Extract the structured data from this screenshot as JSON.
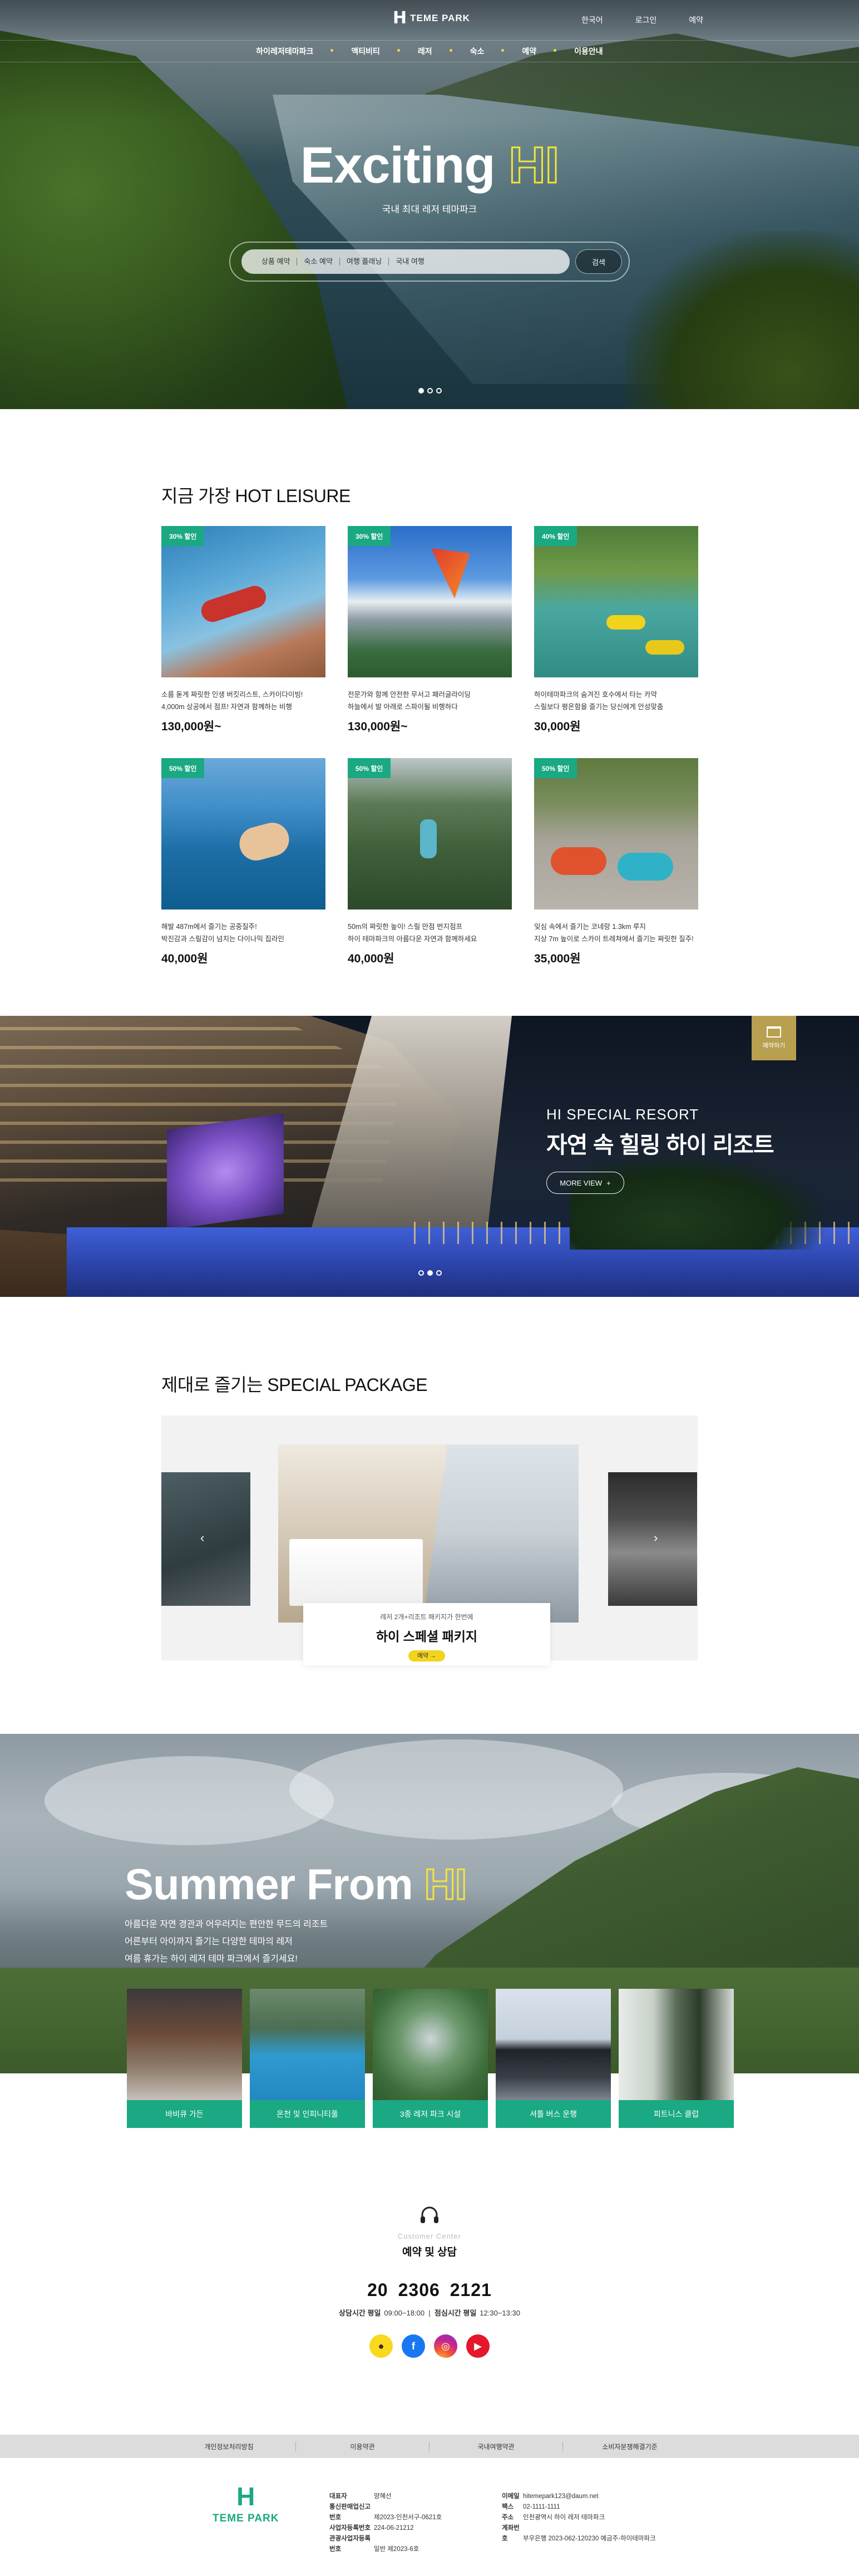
{
  "header": {
    "logo_text": "TEME PARK",
    "util": [
      "한국어",
      "로그인",
      "예약"
    ],
    "nav": [
      "하이레저테마파크",
      "액티비티",
      "레저",
      "숙소",
      "예약",
      "이용안내"
    ]
  },
  "hero": {
    "title_word": "Exciting",
    "title_hi": "HI",
    "subtitle": "국내 최대 레저 테마파크",
    "search_tabs": [
      "상품 예약",
      "숙소 예약",
      "여행 플래닝",
      "국내 여행"
    ],
    "search_button": "검색"
  },
  "hot": {
    "title": "지금 가장 HOT LEISURE",
    "items": [
      {
        "badge": "30% 할인",
        "desc1": "소름 돋게 짜릿한 인생 버킷리스트, 스카이다이빙!",
        "desc2": "4,000m 상공에서 점프! 자연과 함께하는 비행",
        "price": "130,000원~"
      },
      {
        "badge": "30% 할인",
        "desc1": "전문가와 함께 안전한 무서고 패러글라이딩",
        "desc2": "하늘에서 발 아래로 스파이될 비행하다",
        "price": "130,000원~"
      },
      {
        "badge": "40% 할인",
        "desc1": "하이테마파크의 숨겨진 호수에서 타는 카약",
        "desc2": "스릴보다 평온함을 즐기는 당신에게 안성맞춤",
        "price": "30,000원"
      },
      {
        "badge": "50% 할인",
        "desc1": "해발 487m에서 즐기는 공중질주!",
        "desc2": "박진감과 스릴감이 넘치는 다이나믹 집라인",
        "price": "40,000원"
      },
      {
        "badge": "50% 할인",
        "desc1": "50m의 짜릿한 높이! 스릴 만점 번지점프",
        "desc2": "하이 테마파크의 아름다운 자연과 함께하세요",
        "price": "40,000원"
      },
      {
        "badge": "50% 할인",
        "desc1": "잊심 속에서 즐기는 코네랑 1.3km 루지",
        "desc2": "지상 7m 높이로 스카이 트레쳐에서 즐기는 짜릿한 질주!",
        "price": "35,000원"
      }
    ]
  },
  "resort": {
    "tag": "예약하기",
    "eyebrow": "HI SPECIAL RESORT",
    "headline": "자연 속 힐링 하이 리조트",
    "more": "MORE VIEW"
  },
  "package": {
    "title": "제대로 즐기는  SPECIAL PACKAGE",
    "small": "레저 2개+리조트 패키지가 한번에",
    "name": "하이 스페셜 패키지",
    "button": "예약 →"
  },
  "summer": {
    "title_word": "Summer From",
    "title_hi": "HI",
    "lines": [
      "아름다운 자연 경관과 어우러지는 편안한 무드의 리조트",
      "어른부터 아이까지 즐기는 다양한 테마의 레저",
      "여름 휴가는 하이 레저 테마 파크에서 즐기세요!"
    ],
    "cards": [
      "바비큐 가든",
      "온천 및 인피니티풀",
      "3종 레저 파크 시설",
      "셔틀 버스 운행",
      "피트니스 클럽"
    ]
  },
  "contact": {
    "en": "Customer Center",
    "ko": "예약 및 상담",
    "phone": "20 2306 2121",
    "hours_label1": "상담시간 평일",
    "hours1": "09:00~18:00",
    "hours_label2": "점심시간 평일",
    "hours2": "12:30~13:30"
  },
  "footer": {
    "links": [
      "개인정보처리방침",
      "이용약관",
      "국내여행약관",
      "소비자분쟁해결기준"
    ],
    "logo_text": "TEME PARK",
    "col1": [
      {
        "k": "대표자",
        "v": "양혜선"
      },
      {
        "k": "통신판매업신고번호",
        "v": "제2023-인천서구-0621호"
      },
      {
        "k": "사업자등록번호",
        "v": "224-06-21212"
      },
      {
        "k": "관광사업자등록번호",
        "v": "일반 제2023-6호"
      }
    ],
    "col2": [
      {
        "k": "이메일",
        "v": "hitemepark123@daum.net"
      },
      {
        "k": "팩스",
        "v": "02-1111-1111"
      },
      {
        "k": "주소",
        "v": "인천광역시 하이 레저 테마파크"
      },
      {
        "k": "계좌번호",
        "v": "부우은행 2023-062-120230 예금주-하이테마파크"
      }
    ]
  },
  "colors": {
    "accent": "#1aa982",
    "hi_yellow": "#f3e33c",
    "button_yellow": "#f2d41c"
  }
}
